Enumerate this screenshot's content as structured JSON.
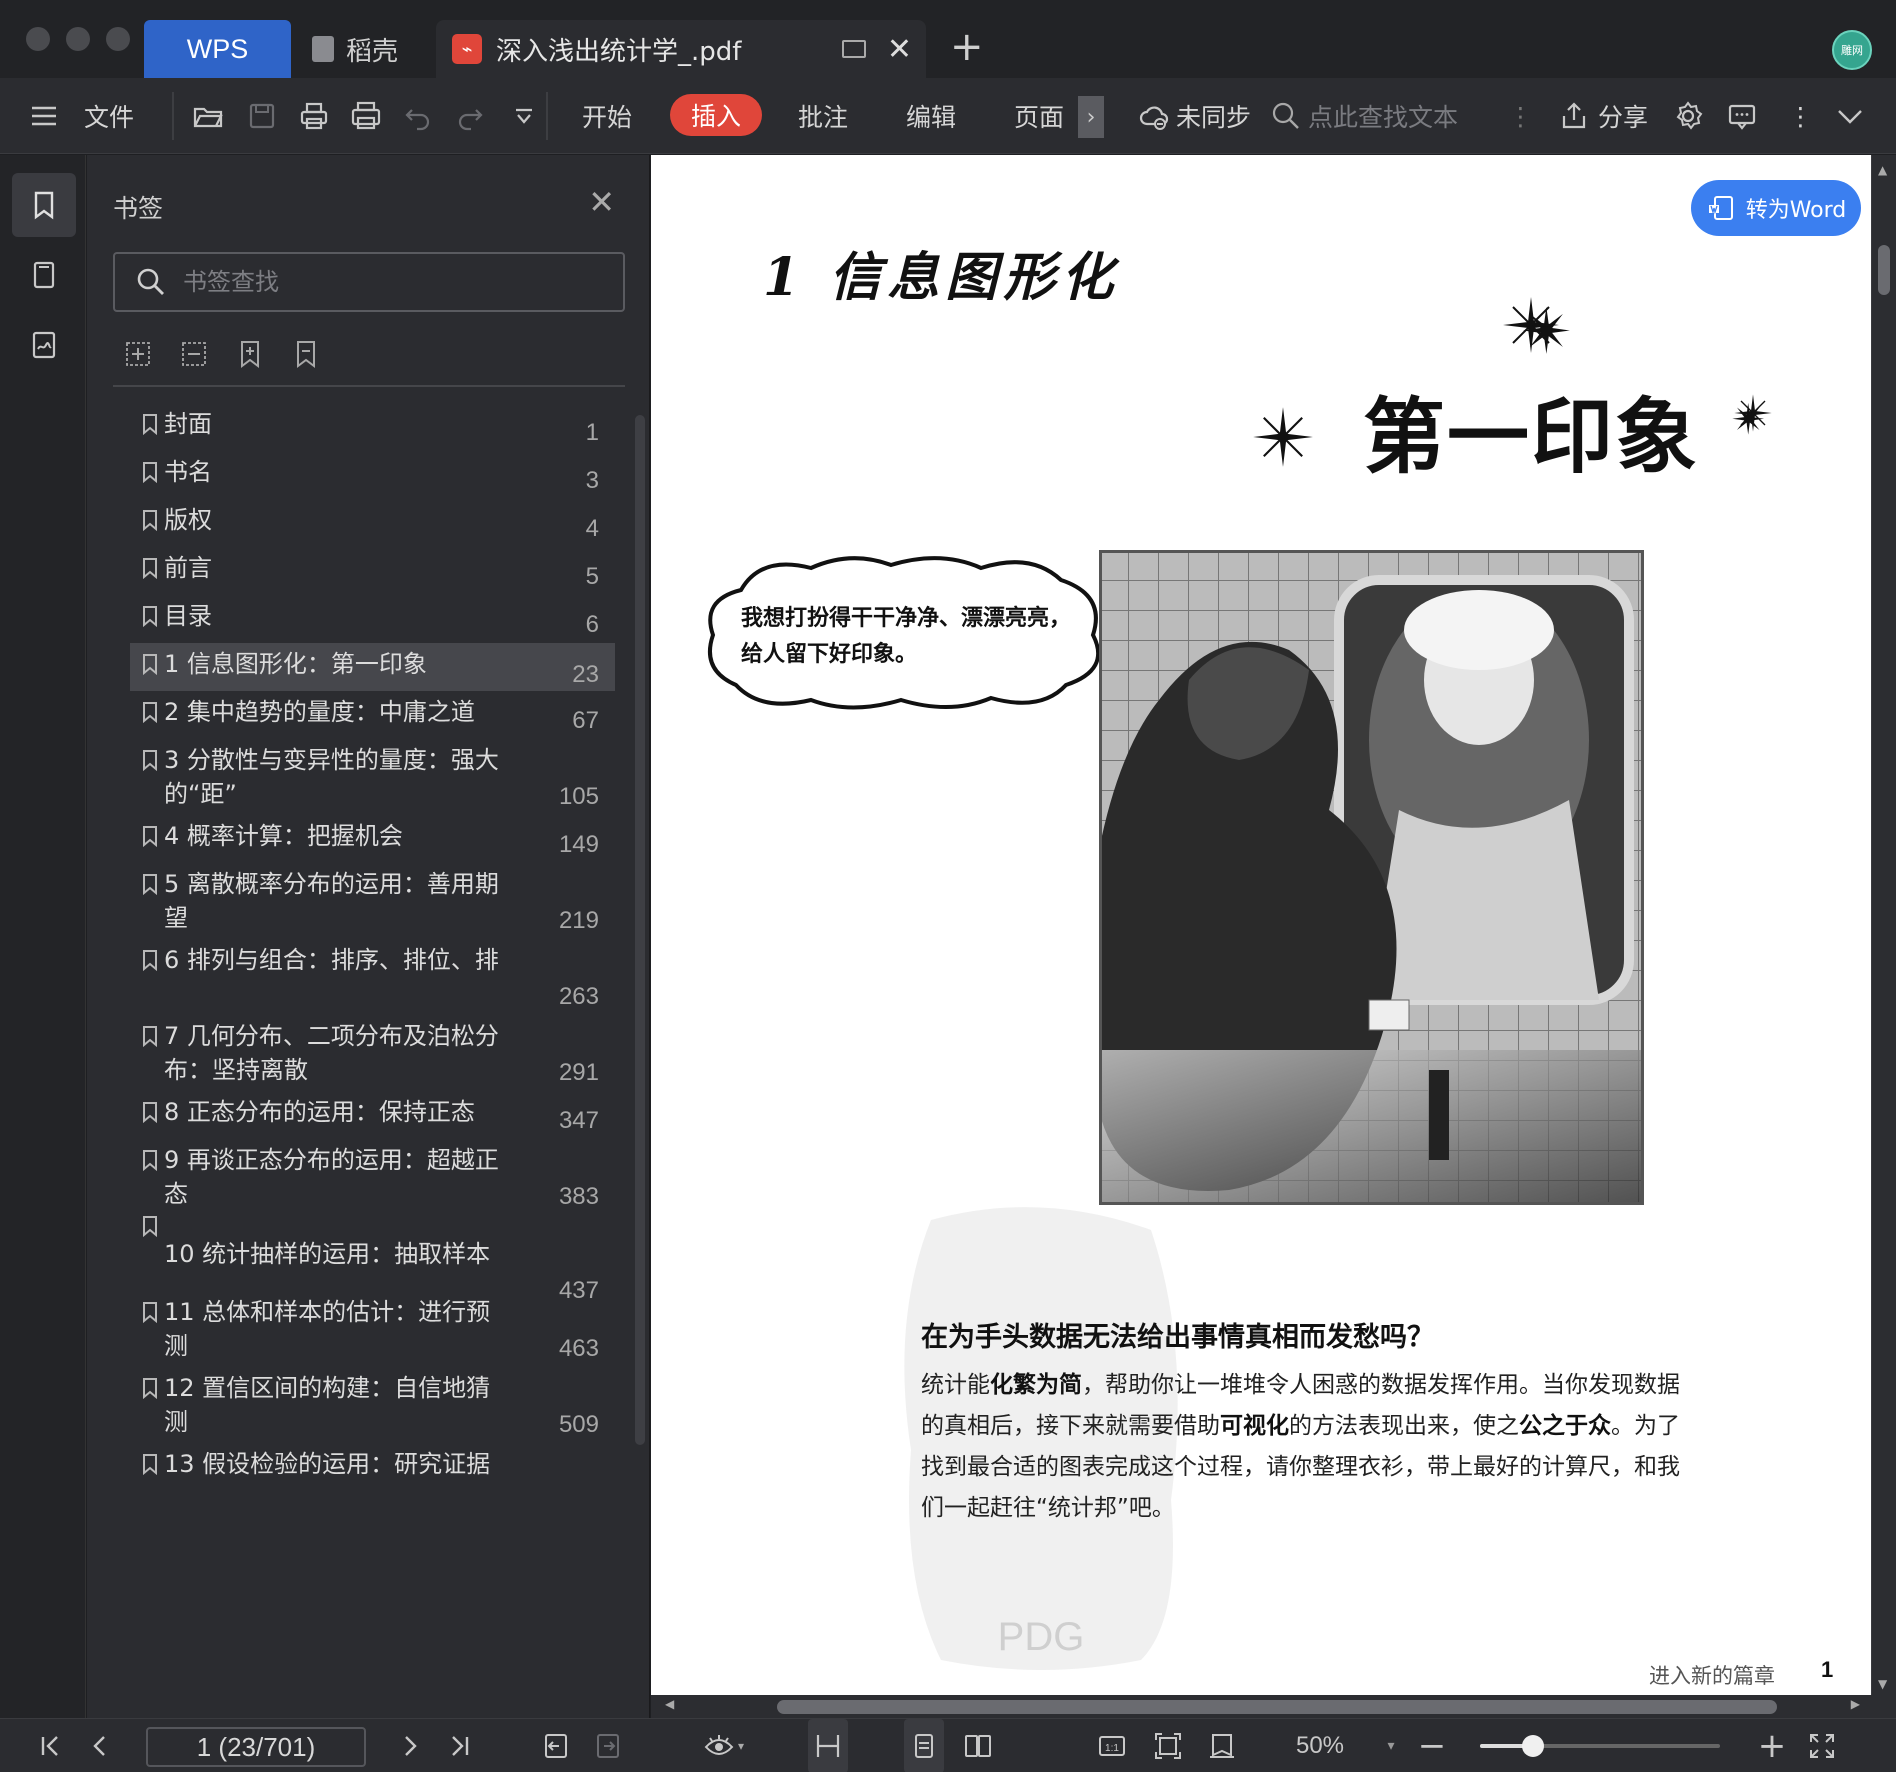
{
  "tabs": {
    "wps": "WPS",
    "daoke": "稻壳",
    "pdf_file": "深入浅出统计学_.pdf"
  },
  "avatar": "雕网",
  "toolbar": {
    "menu_file": "文件",
    "tabs": [
      "开始",
      "插入",
      "批注",
      "编辑",
      "页面"
    ],
    "active_tab": "插入",
    "sync": "未同步",
    "search_placeholder": "点此查找文本",
    "share": "分享"
  },
  "panel": {
    "title": "书签",
    "search_placeholder": "书签查找",
    "bookmarks": [
      {
        "label": "封面",
        "page": "1"
      },
      {
        "label": "书名",
        "page": "3"
      },
      {
        "label": "版权",
        "page": "4"
      },
      {
        "label": "前言",
        "page": "5"
      },
      {
        "label": "目录",
        "page": "6"
      },
      {
        "label": "1  信息图形化：第一印象",
        "page": "23"
      },
      {
        "label": "2  集中趋势的量度：中庸之道",
        "page": "67"
      },
      {
        "label": " 3  分散性与变异性的量度：强大的“距”",
        "page": "105"
      },
      {
        "label": "4  概率计算：把握机会",
        "page": "149"
      },
      {
        "label": "5  离散概率分布的运用：善用期望",
        "page": "219"
      },
      {
        "label": "6  排列与组合：排序、排位、排",
        "page": "263"
      },
      {
        "label": "7  几何分布、二项分布及泊松分布：坚持离散",
        "page": "291"
      },
      {
        "label": "8  正态分布的运用：保持正态",
        "page": "347"
      },
      {
        "label": "9  再谈正态分布的运用：超越正态",
        "page": "383"
      },
      {
        "label": "10  统计抽样的运用：抽取样本",
        "page": "437"
      },
      {
        "label": "11  总体和样本的估计：进行预测",
        "page": "463"
      },
      {
        "label": "12  置信区间的构建：自信地猜测",
        "page": "509"
      },
      {
        "label": "13  假设检验的运用：研究证据",
        "page": ""
      }
    ],
    "active_index": 5
  },
  "document": {
    "convert_button": "转为Word",
    "chapter_heading": "1 信息图形化",
    "chapter_subtitle": "第一印象",
    "bubble_text": "我想打扮得干干净净、漂漂亮亮，给人留下好印象。",
    "section_heading": "在为手头数据无法给出事情真相而发愁吗？",
    "body_segments": [
      {
        "t": "统计能",
        "b": false
      },
      {
        "t": "化繁为简",
        "b": true
      },
      {
        "t": "，帮助你让一堆堆令人困惑的数据发挥作用。当你发现数据的真相后，接下来就需要借助",
        "b": false
      },
      {
        "t": "可视化",
        "b": true
      },
      {
        "t": "的方法表现出来，使之",
        "b": false
      },
      {
        "t": "公之于众",
        "b": true
      },
      {
        "t": "。为了找到最合适的图表完成这个过程，请你整理衣衫，带上最好的计算尺，和我们一起赶往“统计邦”吧。",
        "b": false
      }
    ],
    "watermark": "PDG",
    "footer_text": "进入新的篇章",
    "footer_page": "1"
  },
  "statusbar": {
    "page_indicator": "1 (23/701)",
    "zoom": "50%",
    "zoom_fraction": 0.22
  },
  "colors": {
    "accent_red": "#e0463a",
    "accent_blue": "#3b7ff0",
    "wps_tab": "#2f64c8"
  }
}
